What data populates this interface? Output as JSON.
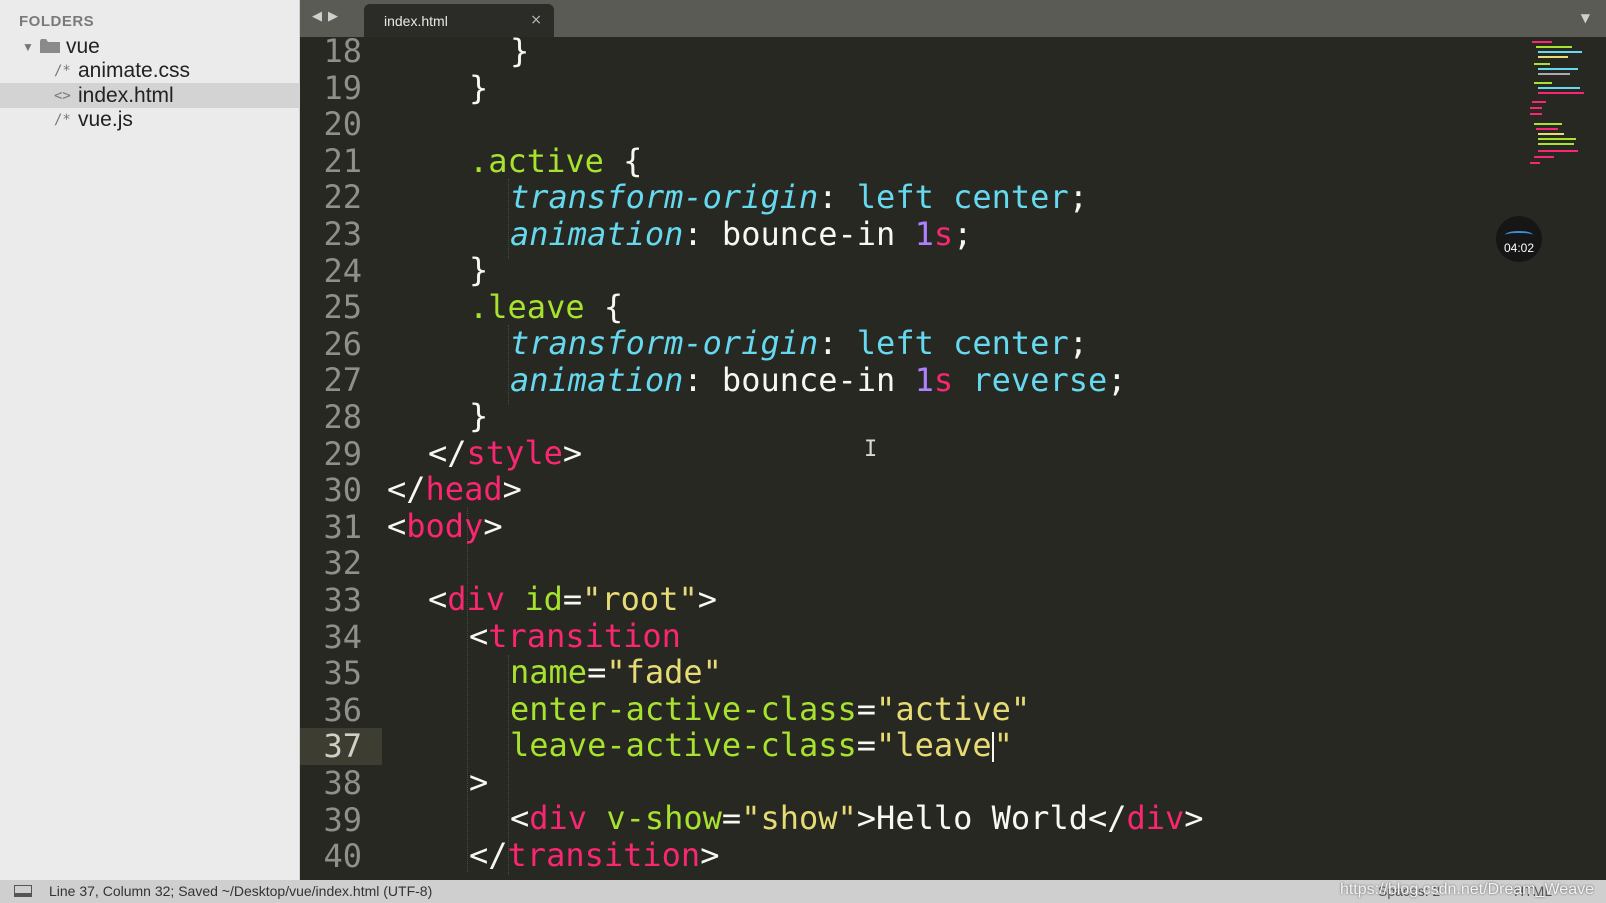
{
  "sidebar": {
    "header": "FOLDERS",
    "folder": "vue",
    "files": [
      {
        "name": "animate.css",
        "icon": "/*"
      },
      {
        "name": "index.html",
        "icon": "<>"
      },
      {
        "name": "vue.js",
        "icon": "/*"
      }
    ]
  },
  "tabs": [
    {
      "title": "index.html",
      "close": "×"
    }
  ],
  "editor": {
    "line_numbers": [
      "18",
      "19",
      "20",
      "21",
      "22",
      "23",
      "24",
      "25",
      "26",
      "27",
      "28",
      "29",
      "30",
      "31",
      "32",
      "33",
      "34",
      "35",
      "36",
      "37",
      "38",
      "39",
      "40"
    ],
    "current_line": "37",
    "lines": {
      "l18": {
        "t1": "}"
      },
      "l19": {
        "t1": "}"
      },
      "l21": {
        "t1": ".active",
        "t2": " {"
      },
      "l22": {
        "t1": "transform-origin",
        "t2": ": ",
        "t3": "left",
        "t4": " ",
        "t5": "center",
        "t6": ";"
      },
      "l23": {
        "t1": "animation",
        "t2": ": bounce-in ",
        "t3": "1",
        "t4": "s",
        "t5": ";"
      },
      "l24": {
        "t1": "}"
      },
      "l25": {
        "t1": ".leave",
        "t2": " {"
      },
      "l26": {
        "t1": "transform-origin",
        "t2": ": ",
        "t3": "left",
        "t4": " ",
        "t5": "center",
        "t6": ";"
      },
      "l27": {
        "t1": "animation",
        "t2": ": bounce-in ",
        "t3": "1",
        "t4": "s",
        "t5": " ",
        "t6": "reverse",
        "t7": ";"
      },
      "l28": {
        "t1": "}"
      },
      "l29": {
        "t1": "</",
        "t2": "style",
        "t3": ">"
      },
      "l30": {
        "t1": "</",
        "t2": "head",
        "t3": ">"
      },
      "l31": {
        "t1": "<",
        "t2": "body",
        "t3": ">"
      },
      "l33": {
        "t1": "<",
        "t2": "div",
        "t3": " ",
        "t4": "id",
        "t5": "=",
        "t6": "\"root\"",
        "t7": ">"
      },
      "l34": {
        "t1": "<",
        "t2": "transition"
      },
      "l35": {
        "t1": "name",
        "t2": "=",
        "t3": "\"fade\""
      },
      "l36": {
        "t1": "enter-active-class",
        "t2": "=",
        "t3": "\"active\""
      },
      "l37": {
        "t1": "leave-active-class",
        "t2": "=",
        "t3": "\"leave",
        "t4": "\""
      },
      "l38": {
        "t1": ">"
      },
      "l39": {
        "t1": "<",
        "t2": "div",
        "t3": " ",
        "t4": "v-show",
        "t5": "=",
        "t6": "\"show\"",
        "t7": ">Hello World</",
        "t8": "div",
        "t9": ">"
      },
      "l40": {
        "t1": "</",
        "t2": "transition",
        "t3": ">"
      }
    }
  },
  "overlay": {
    "timer": "04:02"
  },
  "statusbar": {
    "text": "Line 37, Column 32; Saved ~/Desktop/vue/index.html (UTF-8)",
    "spaces": "Spaces: 2",
    "syntax": "HTML",
    "watermark": "https://blog.csdn.net/Dream_Weave"
  },
  "colors": {
    "editor_bg": "#272822",
    "tag": "#f92672",
    "attr": "#a6e22e",
    "string": "#e6db74",
    "property": "#66d9ef",
    "number": "#ae81ff"
  }
}
